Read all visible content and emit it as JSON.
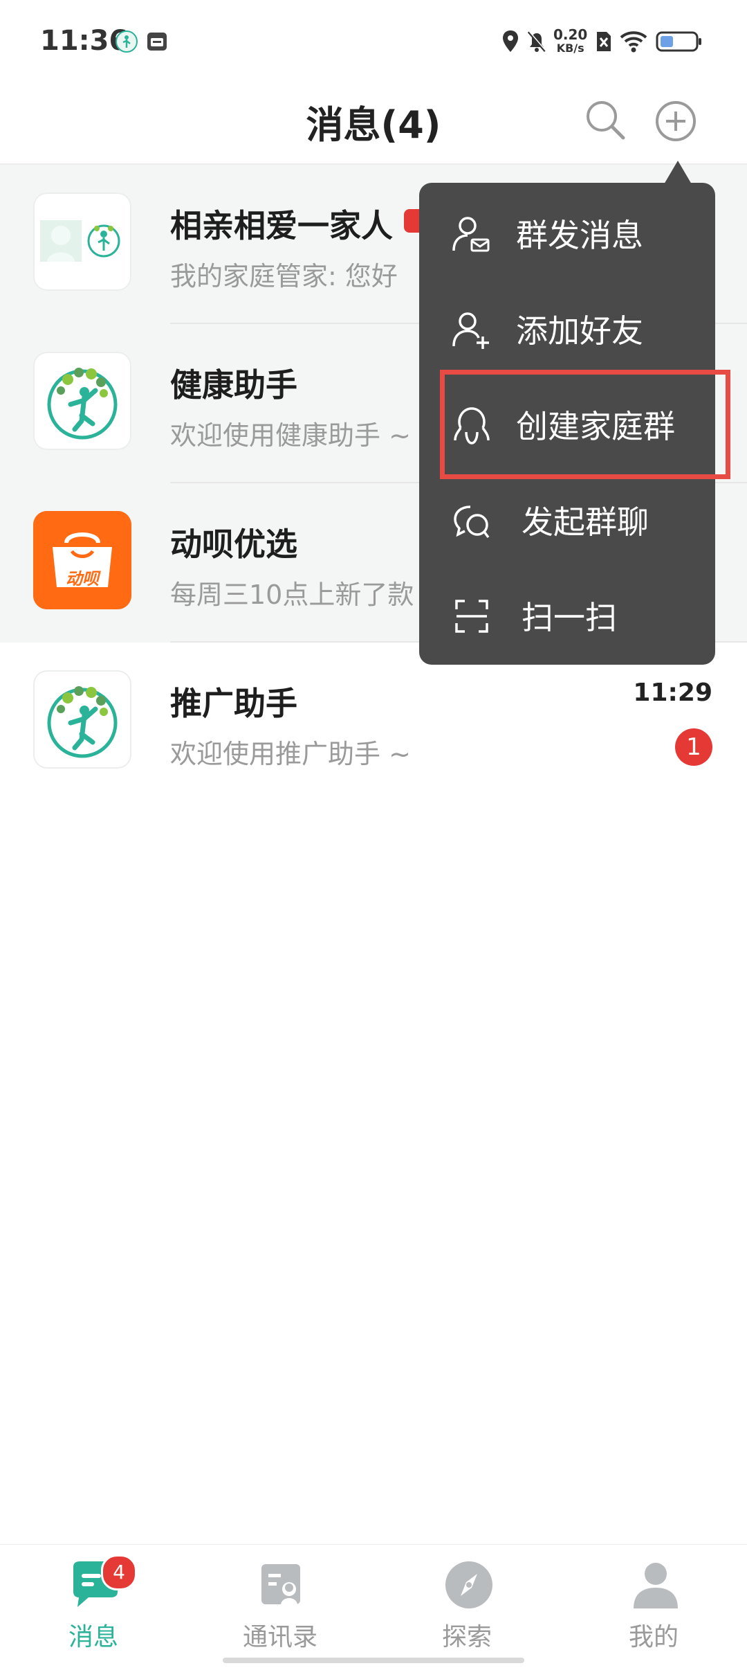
{
  "status_bar": {
    "time": "11:36",
    "net_speed_value": "0.20",
    "net_speed_unit": "KB/s"
  },
  "header": {
    "title": "消息(4)",
    "search_icon": "search-icon",
    "add_icon": "plus-circle-icon"
  },
  "conversations": [
    {
      "name": "相亲相爱一家人",
      "preview": "我的家庭管家: 您好",
      "time": "",
      "unread": ""
    },
    {
      "name": "健康助手",
      "preview": "欢迎使用健康助手 ~",
      "time": "",
      "unread": ""
    },
    {
      "name": "动呗优选",
      "preview": "每周三10点上新了款",
      "time": "",
      "unread": "",
      "logo_text": "动呗"
    },
    {
      "name": "推广助手",
      "preview": "欢迎使用推广助手 ~",
      "time": "11:29",
      "unread": "1"
    }
  ],
  "popup_menu": {
    "items": [
      {
        "label": "群发消息",
        "icon": "broadcast-user-icon"
      },
      {
        "label": "添加好友",
        "icon": "add-friend-icon"
      },
      {
        "label": "创建家庭群",
        "icon": "family-group-icon"
      },
      {
        "label": "发起群聊",
        "icon": "group-chat-icon"
      },
      {
        "label": "扫一扫",
        "icon": "scan-icon"
      }
    ],
    "highlighted_index": 2
  },
  "tab_bar": {
    "tabs": [
      {
        "label": "消息",
        "icon": "message-icon",
        "badge": "4",
        "active": true
      },
      {
        "label": "通讯录",
        "icon": "contacts-icon",
        "active": false
      },
      {
        "label": "探索",
        "icon": "compass-icon",
        "active": false
      },
      {
        "label": "我的",
        "icon": "profile-icon",
        "active": false
      }
    ]
  },
  "colors": {
    "accent": "#2bb39a",
    "badge": "#e53935",
    "popup_bg": "#4a4a4a",
    "highlight": "#e84a44",
    "brand_orange": "#ff6a13"
  }
}
